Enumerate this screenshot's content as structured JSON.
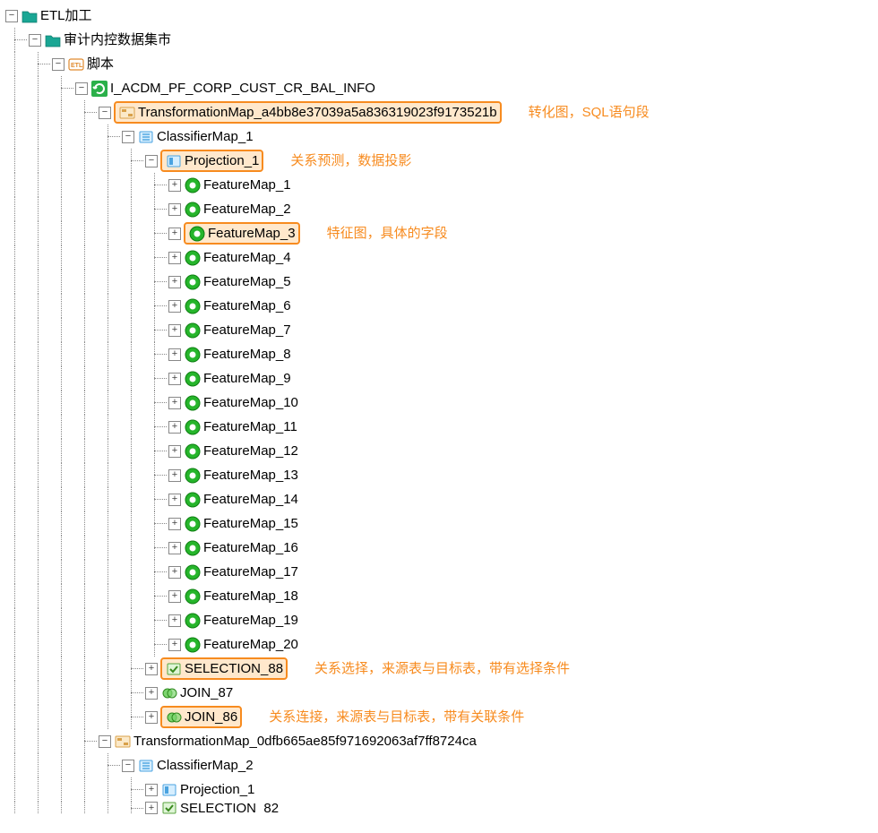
{
  "tree": {
    "root": "ETL加工",
    "l1": "审计内控数据集市",
    "l2": "脚本",
    "l3": "I_ACDM_PF_CORP_CUST_CR_BAL_INFO",
    "tmap1": "TransformationMap_a4bb8e37039a5a836319023f9173521b",
    "classifier1": "ClassifierMap_1",
    "projection1": "Projection_1",
    "features": [
      "FeatureMap_1",
      "FeatureMap_2",
      "FeatureMap_3",
      "FeatureMap_4",
      "FeatureMap_5",
      "FeatureMap_6",
      "FeatureMap_7",
      "FeatureMap_8",
      "FeatureMap_9",
      "FeatureMap_10",
      "FeatureMap_11",
      "FeatureMap_12",
      "FeatureMap_13",
      "FeatureMap_14",
      "FeatureMap_15",
      "FeatureMap_16",
      "FeatureMap_17",
      "FeatureMap_18",
      "FeatureMap_19",
      "FeatureMap_20"
    ],
    "selection88": "SELECTION_88",
    "join87": "JOIN_87",
    "join86": "JOIN_86",
    "tmap2": "TransformationMap_0dfb665ae85f971692063af7ff8724ca",
    "classifier2": "ClassifierMap_2",
    "projection2": "Projection_1",
    "selection82": "SELECTION_82"
  },
  "annotations": {
    "tmap1": "转化图，SQL语句段",
    "projection1": "关系预测，数据投影",
    "featuremap3": "特征图，具体的字段",
    "selection88": "关系选择，来源表与目标表，带有选择条件",
    "join86": "关系连接，来源表与目标表，带有关联条件"
  },
  "glyphs": {
    "plus": "+",
    "minus": "−"
  }
}
